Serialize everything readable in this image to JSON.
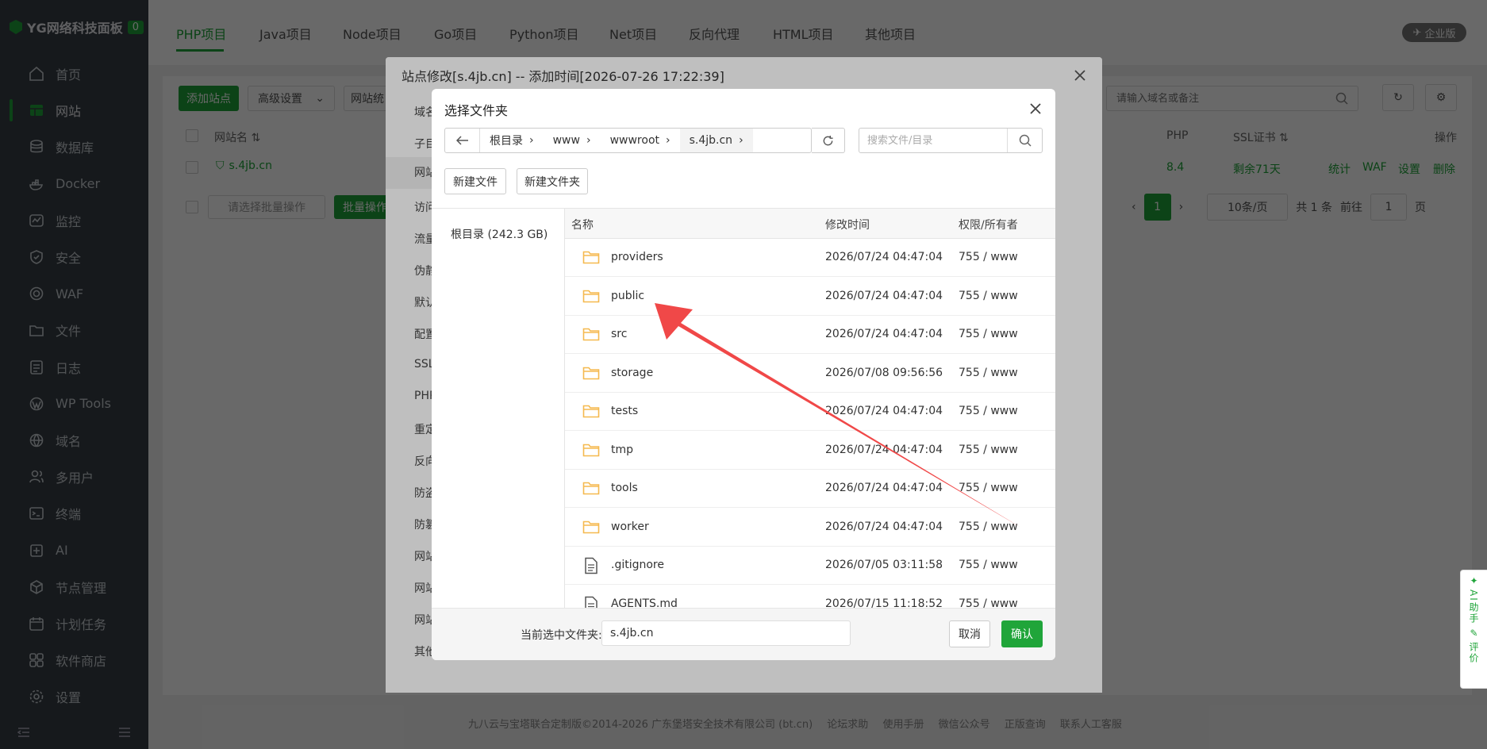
{
  "brand": {
    "name": "YG网络科技面板",
    "badge": "0"
  },
  "nav": [
    {
      "label": "首页",
      "icon": "home-icon"
    },
    {
      "label": "网站",
      "icon": "website-icon",
      "active": true
    },
    {
      "label": "数据库",
      "icon": "database-icon"
    },
    {
      "label": "Docker",
      "icon": "docker-icon"
    },
    {
      "label": "监控",
      "icon": "monitor-icon"
    },
    {
      "label": "安全",
      "icon": "shield-icon"
    },
    {
      "label": "WAF",
      "icon": "waf-icon"
    },
    {
      "label": "文件",
      "icon": "folder-icon"
    },
    {
      "label": "日志",
      "icon": "log-icon"
    },
    {
      "label": "WP Tools",
      "icon": "wordpress-icon"
    },
    {
      "label": "域名",
      "icon": "globe-icon"
    },
    {
      "label": "多用户",
      "icon": "users-icon"
    },
    {
      "label": "终端",
      "icon": "terminal-icon"
    },
    {
      "label": "AI",
      "icon": "ai-icon"
    },
    {
      "label": "节点管理",
      "icon": "node-icon"
    },
    {
      "label": "计划任务",
      "icon": "calendar-icon"
    },
    {
      "label": "软件商店",
      "icon": "store-icon"
    },
    {
      "label": "设置",
      "icon": "gear-icon"
    }
  ],
  "project_tabs": [
    "PHP项目",
    "Java项目",
    "Node项目",
    "Go项目",
    "Python项目",
    "Net项目",
    "反向代理",
    "HTML项目",
    "其他项目"
  ],
  "enterprise_badge": "企业版",
  "toolbar": {
    "add_site": "添加站点",
    "advanced": "高级设置",
    "site_cat": "网站统",
    "search_placeholder": "请输入域名或备注"
  },
  "site_table": {
    "headers": {
      "name": "网站名",
      "php": "PHP",
      "ssl": "SSL证书",
      "ops": "操作"
    },
    "row": {
      "name": "s.4jb.cn",
      "php": "8.4",
      "ssl": "剩余71天",
      "ops": [
        "统计",
        "WAF",
        "设置",
        "删除"
      ]
    }
  },
  "batch": {
    "select_placeholder": "请选择批量操作",
    "button": "批量操作"
  },
  "pagination": {
    "page": "1",
    "per_page": "10条/页",
    "total": "共 1 条",
    "goto": "前往",
    "goto_value": "1",
    "page_unit": "页"
  },
  "footer": {
    "copyright": "九八云与宝塔联合定制版©2014-2026 广东堡塔安全技术有限公司 (bt.cn)",
    "links": [
      "论坛求助",
      "使用手册",
      "微信公众号",
      "正版查询",
      "联系人工客服"
    ]
  },
  "site_dialog": {
    "title": "站点修改[s.4jb.cn] -- 添加时间[2026-07-26 17:22:39]",
    "menu": [
      "域名",
      "子目",
      "网站",
      "访问",
      "流量",
      "伪静",
      "默认",
      "配置",
      "SSL",
      "PHP",
      "重定",
      "反向",
      "防盗",
      "防篡",
      "网站",
      "网站",
      "网站",
      "其他"
    ]
  },
  "file_dialog": {
    "title": "选择文件夹",
    "breadcrumb": [
      "根目录",
      "www",
      "wwwroot",
      "s.4jb.cn"
    ],
    "search_placeholder": "搜索文件/目录",
    "new_file": "新建文件",
    "new_folder": "新建文件夹",
    "left_root": "根目录 (242.3 GB)",
    "columns": {
      "name": "名称",
      "mtime": "修改时间",
      "perm": "权限/所有者"
    },
    "rows": [
      {
        "name": "providers",
        "mtime": "2026/07/24 04:47:04",
        "perm": "755 / www",
        "type": "folder"
      },
      {
        "name": "public",
        "mtime": "2026/07/24 04:47:04",
        "perm": "755 / www",
        "type": "folder"
      },
      {
        "name": "src",
        "mtime": "2026/07/24 04:47:04",
        "perm": "755 / www",
        "type": "folder"
      },
      {
        "name": "storage",
        "mtime": "2026/07/08 09:56:56",
        "perm": "755 / www",
        "type": "folder"
      },
      {
        "name": "tests",
        "mtime": "2026/07/24 04:47:04",
        "perm": "755 / www",
        "type": "folder"
      },
      {
        "name": "tmp",
        "mtime": "2026/07/24 04:47:04",
        "perm": "755 / www",
        "type": "folder"
      },
      {
        "name": "tools",
        "mtime": "2026/07/24 04:47:04",
        "perm": "755 / www",
        "type": "folder"
      },
      {
        "name": "worker",
        "mtime": "2026/07/24 04:47:04",
        "perm": "755 / www",
        "type": "folder"
      },
      {
        "name": ".gitignore",
        "mtime": "2026/07/05 03:11:58",
        "perm": "755 / www",
        "type": "file"
      },
      {
        "name": "AGENTS.md",
        "mtime": "2026/07/15 11:18:52",
        "perm": "755 / www",
        "type": "file"
      }
    ],
    "current_label": "当前选中文件夹:",
    "current_value": "s.4jb.cn",
    "cancel": "取消",
    "confirm": "确认"
  },
  "ai_float": {
    "ai": "AI助手",
    "review": "评价"
  },
  "colors": {
    "accent": "#20a53a",
    "sidebar": "#383e45",
    "arrow": "#f04848",
    "folder": "#f5b94f"
  }
}
